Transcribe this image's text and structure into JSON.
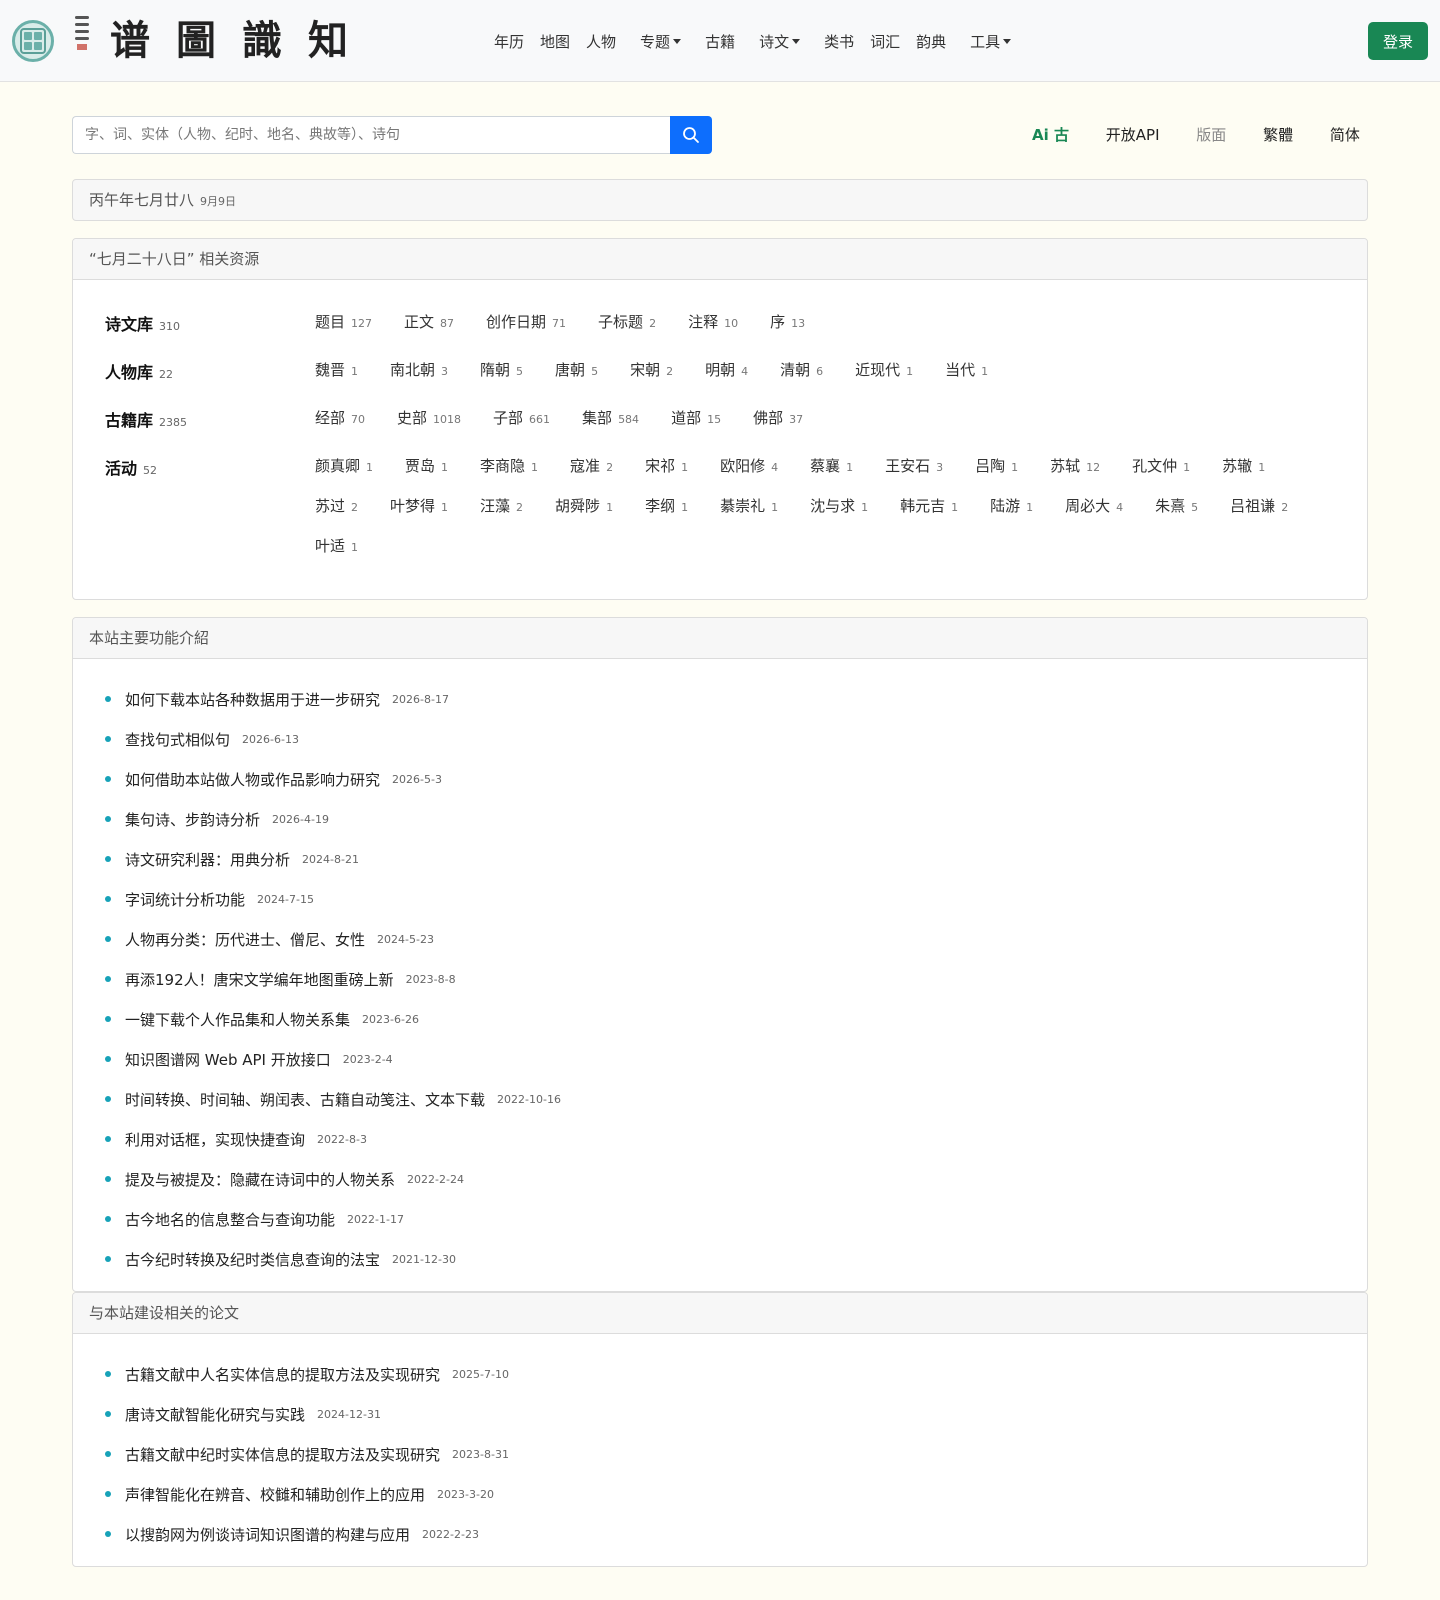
{
  "header": {
    "brand_title": "谱圖識知",
    "nav": [
      {
        "label": "年历",
        "dropdown": false
      },
      {
        "label": "地图",
        "dropdown": false
      },
      {
        "label": "人物",
        "dropdown": false
      },
      {
        "label": "专题",
        "dropdown": true
      },
      {
        "label": "古籍",
        "dropdown": false
      },
      {
        "label": "诗文",
        "dropdown": true
      },
      {
        "label": "类书",
        "dropdown": false
      },
      {
        "label": "词汇",
        "dropdown": false
      },
      {
        "label": "韵典",
        "dropdown": false
      },
      {
        "label": "工具",
        "dropdown": true
      }
    ],
    "login_label": "登录"
  },
  "search": {
    "placeholder": "字、词、实体（人物、纪时、地名、典故等）、诗句",
    "value": ""
  },
  "right_links": {
    "ai": "Ai 古",
    "api": "开放API",
    "layout": "版面",
    "traditional": "繁體",
    "simplified": "简体"
  },
  "date": {
    "lunar": "丙午年七月廿八",
    "solar": "9月9日"
  },
  "resources": {
    "title": "“七月二十八日” 相关资源",
    "rows": [
      {
        "label": "诗文库",
        "count": "310",
        "items": [
          {
            "name": "题目",
            "count": "127"
          },
          {
            "name": "正文",
            "count": "87"
          },
          {
            "name": "创作日期",
            "count": "71"
          },
          {
            "name": "子标题",
            "count": "2"
          },
          {
            "name": "注释",
            "count": "10"
          },
          {
            "name": "序",
            "count": "13"
          }
        ]
      },
      {
        "label": "人物库",
        "count": "22",
        "items": [
          {
            "name": "魏晋",
            "count": "1"
          },
          {
            "name": "南北朝",
            "count": "3"
          },
          {
            "name": "隋朝",
            "count": "5"
          },
          {
            "name": "唐朝",
            "count": "5"
          },
          {
            "name": "宋朝",
            "count": "2"
          },
          {
            "name": "明朝",
            "count": "4"
          },
          {
            "name": "清朝",
            "count": "6"
          },
          {
            "name": "近现代",
            "count": "1"
          },
          {
            "name": "当代",
            "count": "1"
          }
        ]
      },
      {
        "label": "古籍库",
        "count": "2385",
        "items": [
          {
            "name": "经部",
            "count": "70"
          },
          {
            "name": "史部",
            "count": "1018"
          },
          {
            "name": "子部",
            "count": "661"
          },
          {
            "name": "集部",
            "count": "584"
          },
          {
            "name": "道部",
            "count": "15"
          },
          {
            "name": "佛部",
            "count": "37"
          }
        ]
      },
      {
        "label": "活动",
        "count": "52",
        "items": [
          {
            "name": "颜真卿",
            "count": "1"
          },
          {
            "name": "贾岛",
            "count": "1"
          },
          {
            "name": "李商隐",
            "count": "1"
          },
          {
            "name": "寇准",
            "count": "2"
          },
          {
            "name": "宋祁",
            "count": "1"
          },
          {
            "name": "欧阳修",
            "count": "4"
          },
          {
            "name": "蔡襄",
            "count": "1"
          },
          {
            "name": "王安石",
            "count": "3"
          },
          {
            "name": "吕陶",
            "count": "1"
          },
          {
            "name": "苏轼",
            "count": "12"
          },
          {
            "name": "孔文仲",
            "count": "1"
          },
          {
            "name": "苏辙",
            "count": "1"
          },
          {
            "name": "苏过",
            "count": "2"
          },
          {
            "name": "叶梦得",
            "count": "1"
          },
          {
            "name": "汪藻",
            "count": "2"
          },
          {
            "name": "胡舜陟",
            "count": "1"
          },
          {
            "name": "李纲",
            "count": "1"
          },
          {
            "name": "綦崇礼",
            "count": "1"
          },
          {
            "name": "沈与求",
            "count": "1"
          },
          {
            "name": "韩元吉",
            "count": "1"
          },
          {
            "name": "陆游",
            "count": "1"
          },
          {
            "name": "周必大",
            "count": "4"
          },
          {
            "name": "朱熹",
            "count": "5"
          },
          {
            "name": "吕祖谦",
            "count": "2"
          },
          {
            "name": "叶适",
            "count": "1"
          }
        ]
      }
    ]
  },
  "features": {
    "title": "本站主要功能介紹",
    "items": [
      {
        "title": "如何下载本站各种数据用于进一步研究",
        "date": "2026-8-17"
      },
      {
        "title": "查找句式相似句",
        "date": "2026-6-13"
      },
      {
        "title": "如何借助本站做人物或作品影响力研究",
        "date": "2026-5-3"
      },
      {
        "title": "集句诗、步韵诗分析",
        "date": "2026-4-19"
      },
      {
        "title": "诗文研究利器：用典分析",
        "date": "2024-8-21"
      },
      {
        "title": "字词统计分析功能",
        "date": "2024-7-15"
      },
      {
        "title": "人物再分类：历代进士、僧尼、女性",
        "date": "2024-5-23"
      },
      {
        "title": "再添192人！唐宋文学编年地图重磅上新",
        "date": "2023-8-8"
      },
      {
        "title": "一键下载个人作品集和人物关系集",
        "date": "2023-6-26"
      },
      {
        "title": "知识图谱网 Web API 开放接口",
        "date": "2023-2-4"
      },
      {
        "title": "时间转换、时间轴、朔闰表、古籍自动笺注、文本下载",
        "date": "2022-10-16"
      },
      {
        "title": "利用对话框，实现快捷查询",
        "date": "2022-8-3"
      },
      {
        "title": "提及与被提及：隐藏在诗词中的人物关系",
        "date": "2022-2-24"
      },
      {
        "title": "古今地名的信息整合与查询功能",
        "date": "2022-1-17"
      },
      {
        "title": "古今纪时转换及纪时类信息查询的法宝",
        "date": "2021-12-30"
      }
    ]
  },
  "papers": {
    "title": "与本站建设相关的论文",
    "items": [
      {
        "title": "古籍文献中人名实体信息的提取方法及实现研究",
        "date": "2025-7-10"
      },
      {
        "title": "唐诗文献智能化研究与实践",
        "date": "2024-12-31"
      },
      {
        "title": "古籍文献中纪时实体信息的提取方法及实现研究",
        "date": "2023-8-31"
      },
      {
        "title": "声律智能化在辨音、校雠和辅助创作上的应用",
        "date": "2023-3-20"
      },
      {
        "title": "以搜韵网为例谈诗词知识图谱的构建与应用",
        "date": "2022-2-23"
      }
    ]
  },
  "colors": {
    "accent_green": "#198754",
    "search_blue": "#0d6efd",
    "bullet_teal": "#17a2b8",
    "page_bg": "#fefdf3"
  },
  "icons": {
    "logo": "circular-seal-logo",
    "search": "search-icon",
    "dropdown": "caret-down-icon",
    "bullet": "dot-icon"
  }
}
